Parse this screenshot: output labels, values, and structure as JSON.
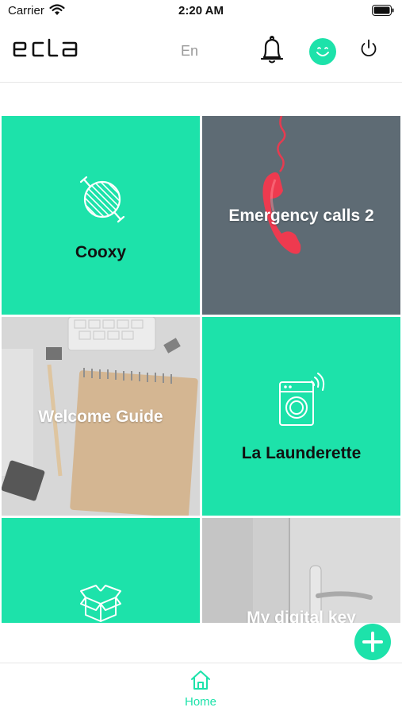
{
  "status_bar": {
    "carrier": "Carrier",
    "time": "2:20 AM"
  },
  "header": {
    "logo_text": "ecla",
    "language": "En"
  },
  "tiles": [
    {
      "label": "Cooxy",
      "icon": "grill-icon"
    },
    {
      "label": "Emergency calls 2",
      "icon": "phone-photo"
    },
    {
      "label": "Welcome Guide",
      "icon": "desk-photo"
    },
    {
      "label": "La Launderette",
      "icon": "washing-machine-icon"
    },
    {
      "label": "",
      "icon": "box-icon"
    },
    {
      "label": "My digital key",
      "icon": "door-photo"
    }
  ],
  "tab_bar": {
    "home_label": "Home"
  },
  "colors": {
    "accent": "#1de2aa",
    "text": "#111111",
    "muted": "#9a9a9a"
  }
}
